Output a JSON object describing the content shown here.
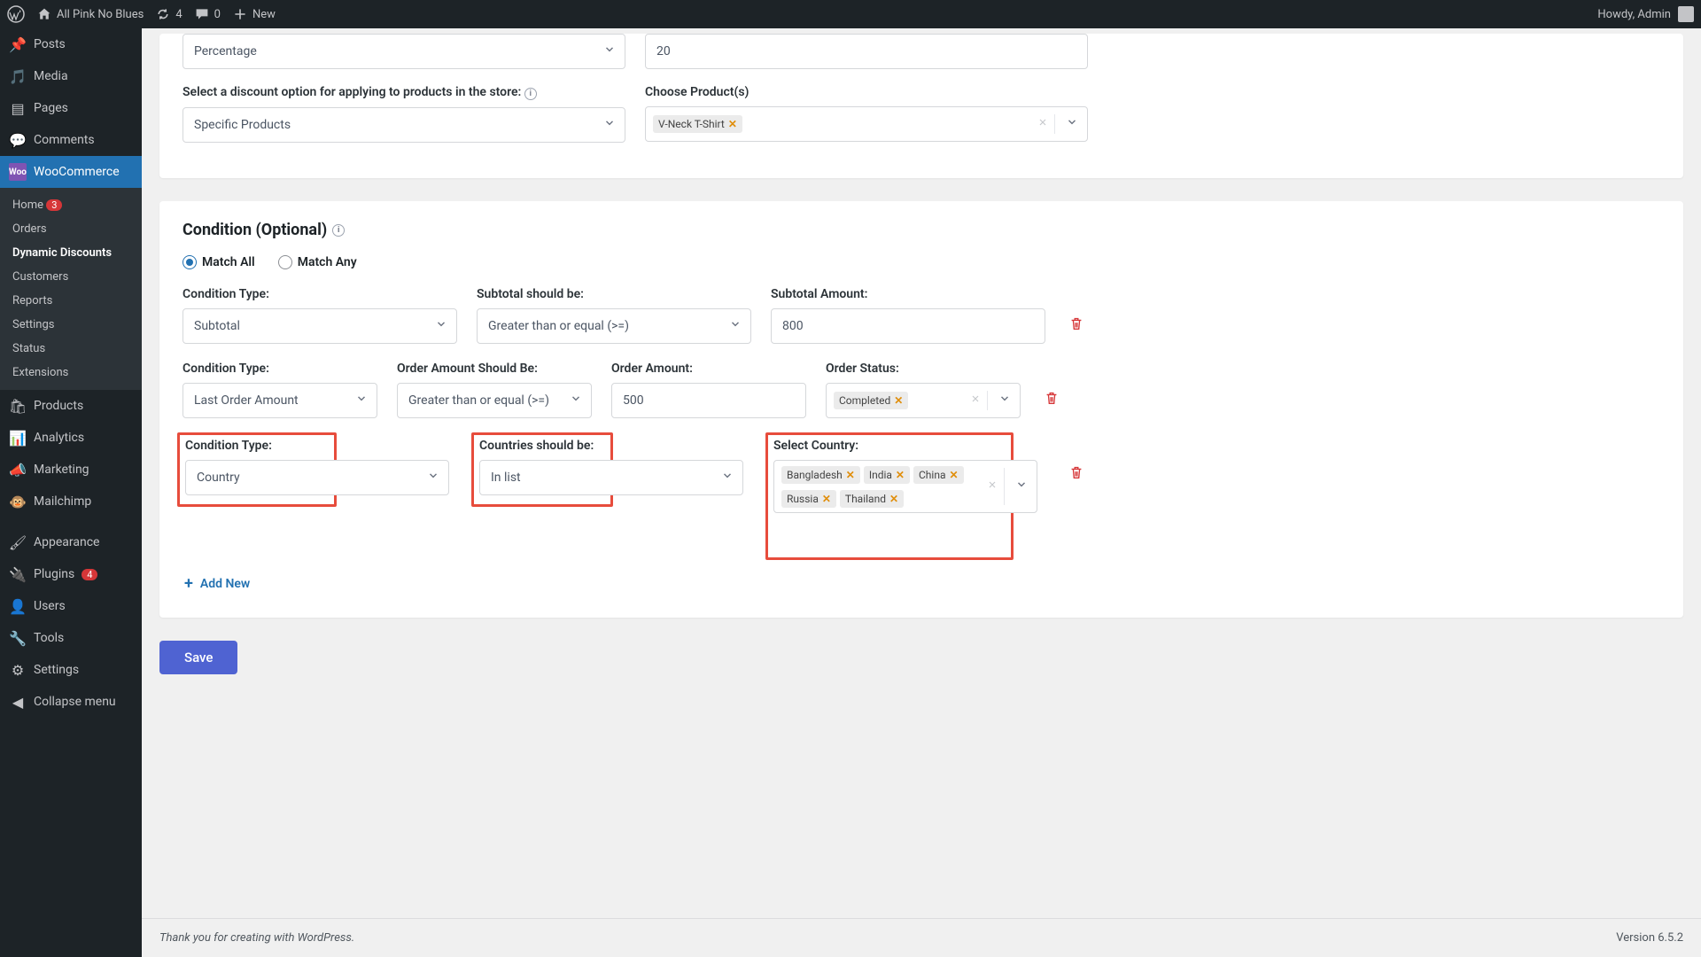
{
  "adminbar": {
    "site_name": "All Pink No Blues",
    "updates": "4",
    "comments": "0",
    "new": "New",
    "howdy": "Howdy, Admin"
  },
  "sidebar": {
    "posts": "Posts",
    "media": "Media",
    "pages": "Pages",
    "comments": "Comments",
    "woocommerce": "WooCommerce",
    "woo_sub": {
      "home": "Home",
      "home_badge": "3",
      "orders": "Orders",
      "dynamic": "Dynamic Discounts",
      "customers": "Customers",
      "reports": "Reports",
      "settings": "Settings",
      "status": "Status",
      "extensions": "Extensions"
    },
    "products": "Products",
    "analytics": "Analytics",
    "marketing": "Marketing",
    "mailchimp": "Mailchimp",
    "appearance": "Appearance",
    "plugins": "Plugins",
    "plugins_badge": "4",
    "users": "Users",
    "tools": "Tools",
    "settings_main": "Settings",
    "collapse": "Collapse menu"
  },
  "top_card": {
    "discount_type": "Percentage",
    "discount_value": "20",
    "option_label": "Select a discount option for applying to products in the store:",
    "option_value": "Specific Products",
    "choose_label": "Choose Product(s)",
    "product_tag": "V-Neck T-Shirt"
  },
  "condition": {
    "title": "Condition (Optional)",
    "match_all": "Match All",
    "match_any": "Match Any",
    "row1": {
      "type_label": "Condition Type:",
      "type_val": "Subtotal",
      "op_label": "Subtotal should be:",
      "op_val": "Greater than or equal (>=)",
      "amt_label": "Subtotal Amount:",
      "amt_val": "800"
    },
    "row2": {
      "type_label": "Condition Type:",
      "type_val": "Last Order Amount",
      "op_label": "Order Amount Should Be:",
      "op_val": "Greater than or equal (>=)",
      "amt_label": "Order Amount:",
      "amt_val": "500",
      "status_label": "Order Status:",
      "status_tag": "Completed"
    },
    "row3": {
      "type_label": "Condition Type:",
      "type_val": "Country",
      "op_label": "Countries should be:",
      "op_val": "In list",
      "sel_label": "Select Country:",
      "countries": [
        "Bangladesh",
        "India",
        "China",
        "Russia",
        "Thailand"
      ]
    },
    "add_new": "Add New"
  },
  "save": "Save",
  "footer": {
    "thanks": "Thank you for creating with WordPress.",
    "version": "Version 6.5.2"
  }
}
